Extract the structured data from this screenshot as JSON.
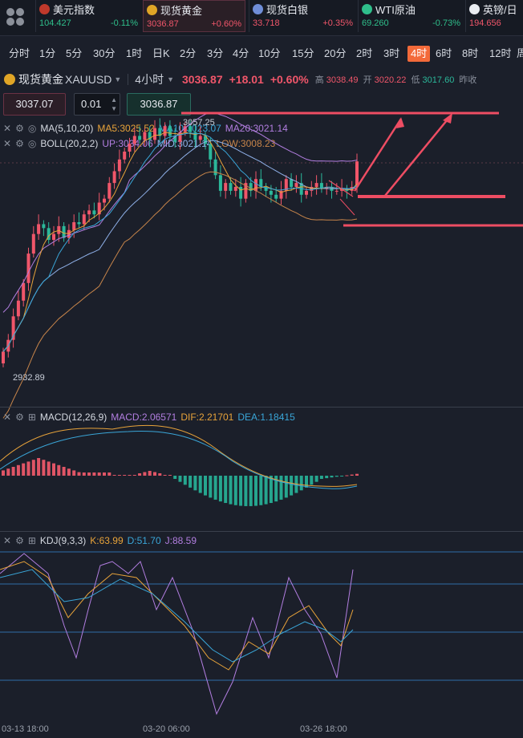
{
  "tickers": [
    {
      "name": "美元指数",
      "price": "104.427",
      "change": "-0.11%",
      "dir": "down",
      "icon_color": "#c0392b"
    },
    {
      "name": "现货黄金",
      "price": "3036.87",
      "change": "+0.60%",
      "dir": "up",
      "icon_color": "#e0a526"
    },
    {
      "name": "现货白银",
      "price": "33.718",
      "change": "+0.35%",
      "dir": "up",
      "icon_color": "#6f8ed8"
    },
    {
      "name": "WTI原油",
      "price": "69.260",
      "change": "-0.73%",
      "dir": "down",
      "icon_color": "#2fbf8b"
    },
    {
      "name": "英镑/日",
      "price": "194.656",
      "change": "",
      "dir": "up",
      "icon_color": "#e9ecf1"
    }
  ],
  "timeframes": [
    "分时",
    "1分",
    "5分",
    "30分",
    "1时",
    "日K",
    "2分",
    "3分",
    "4分",
    "10分",
    "15分",
    "20分",
    "2时",
    "3时",
    "4时",
    "6时",
    "8时",
    "12时",
    "周"
  ],
  "active_timeframe": "4时",
  "symbol": {
    "name": "现货黄金",
    "code": "XAUUSD",
    "period": "4小时",
    "price": "3036.87",
    "change": "+18.01",
    "pct": "+0.60%",
    "high_label": "高",
    "high": "3038.49",
    "open_label": "开",
    "open": "3020.22",
    "low_label": "低",
    "low": "3017.60",
    "prev_label": "昨收"
  },
  "order": {
    "sell_price": "3037.07",
    "qty": "0.01",
    "buy_price": "3036.87"
  },
  "indicators": {
    "ma": {
      "name": "MA(5,10,20)",
      "ma5": "MA5:3025.52",
      "ma10": "MA10:3023.07",
      "ma20": "MA20:3021.14"
    },
    "boll": {
      "name": "BOLL(20,2,2)",
      "up": "UP:3034.06",
      "mid": "MID:3021.14",
      "low": "LOW:3008.23"
    },
    "macd": {
      "name": "MACD(12,26,9)",
      "macd": "MACD:2.06571",
      "dif": "DIF:2.21701",
      "dea": "DEA:1.18415"
    },
    "kdj": {
      "name": "KDJ(9,3,3)",
      "k": "K:63.99",
      "d": "D:51.70",
      "j": "J:88.59"
    }
  },
  "price_labels": {
    "peak": "3057.25",
    "trough": "2932.89"
  },
  "time_labels": [
    "03-13 18:00",
    "03-20 06:00",
    "03-26 18:00"
  ],
  "colors": {
    "up": "#f0566a",
    "down": "#2bb89a",
    "accent": "#f36a3a",
    "bg": "#1b1f2a"
  }
}
